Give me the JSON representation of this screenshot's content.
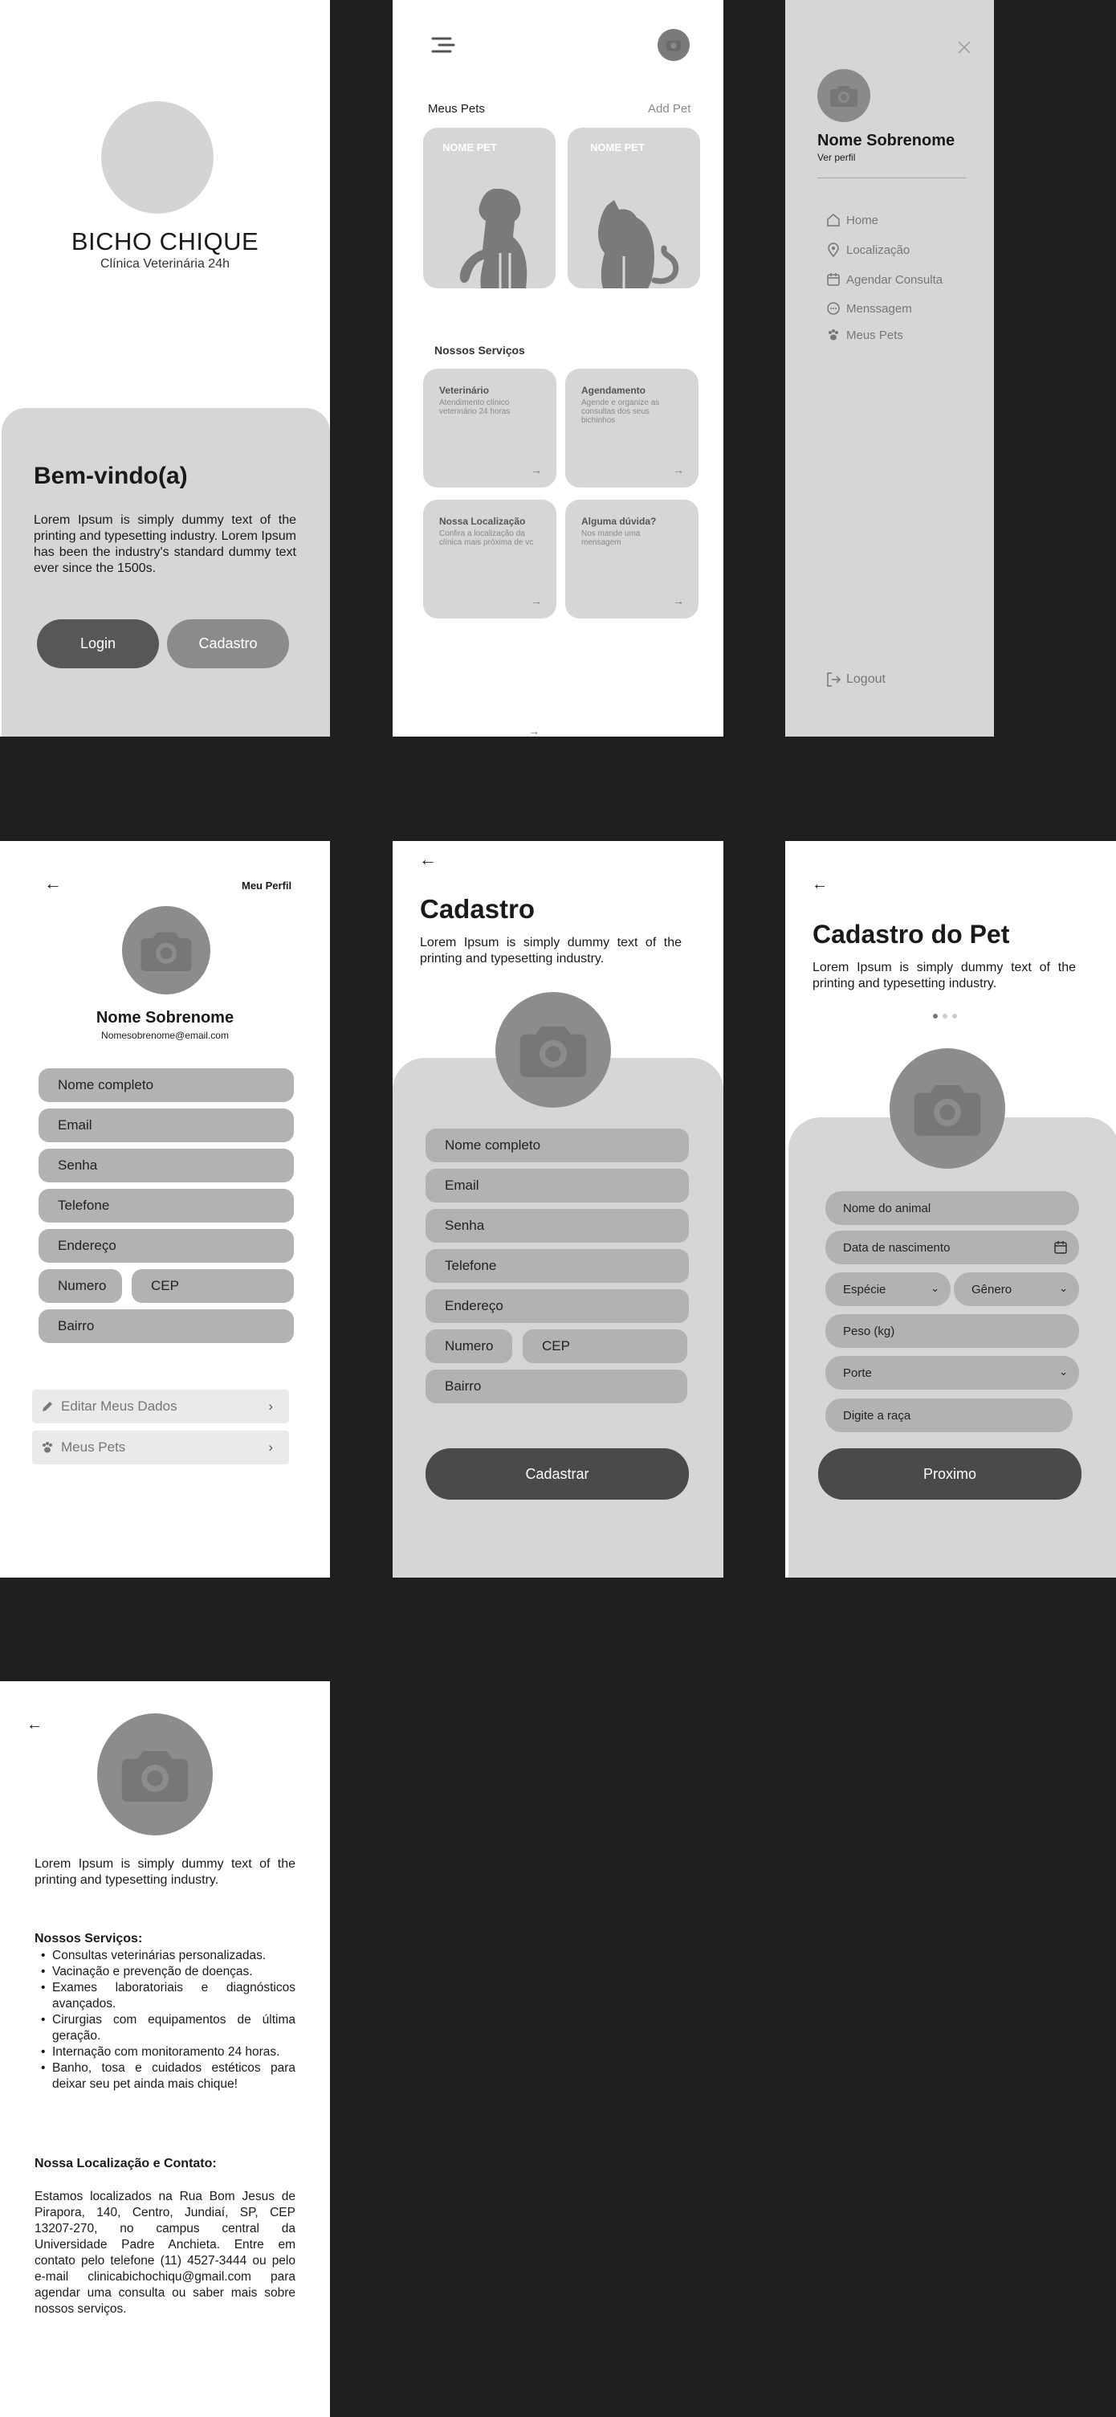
{
  "welcome": {
    "brand": "BICHO CHIQUE",
    "subtitle": "Clínica Veterinária 24h",
    "heading": "Bem-vindo(a)",
    "body": "Lorem Ipsum is simply dummy text of the printing and typesetting industry. Lorem Ipsum has been the industry's standard dummy text ever since the 1500s.",
    "login_label": "Login",
    "signup_label": "Cadastro"
  },
  "home": {
    "my_pets_label": "Meus Pets",
    "add_pet_label": "Add Pet",
    "pet_cards": [
      "NOME PET",
      "NOME PET"
    ],
    "services_label": "Nossos Serviços",
    "services": [
      {
        "title": "Veterinário",
        "desc": "Atendimento clínico veterinário 24 horas"
      },
      {
        "title": "Agendamento",
        "desc": "Agende e organize as consultas dos seus bichinhos"
      },
      {
        "title": "Nossa Localização",
        "desc": "Confira a localização da clínica mais próxima de vc"
      },
      {
        "title": "Alguma dúvida?",
        "desc": "Nos mande uma mensagem"
      }
    ]
  },
  "drawer": {
    "name": "Nome Sobrenome",
    "profile_link": "Ver perfil",
    "items": [
      "Home",
      "Localização",
      "Agendar Consulta",
      "Menssagem",
      "Meus Pets"
    ],
    "logout_label": "Logout"
  },
  "profile": {
    "title": "Meu Perfil",
    "name": "Nome Sobrenome",
    "email": "Nomesobrenome@email.com",
    "fields": {
      "full_name": "Nome completo",
      "email": "Email",
      "password": "Senha",
      "phone": "Telefone",
      "address": "Endereço",
      "number": "Numero",
      "cep": "CEP",
      "district": "Bairro"
    },
    "edit_label": "Editar Meus Dados",
    "pets_label": "Meus Pets"
  },
  "signup": {
    "title": "Cadastro",
    "body": "Lorem Ipsum is simply dummy text of the printing and typesetting industry.",
    "fields": {
      "full_name": "Nome completo",
      "email": "Email",
      "password": "Senha",
      "phone": "Telefone",
      "address": "Endereço",
      "number": "Numero",
      "cep": "CEP",
      "district": "Bairro"
    },
    "submit_label": "Cadastrar"
  },
  "pet_signup": {
    "title": "Cadastro do Pet",
    "body": "Lorem Ipsum is simply dummy text of the printing and typesetting industry.",
    "fields": {
      "animal_name": "Nome do animal",
      "birth_date": "Data de nascimento",
      "species": "Espécie",
      "gender": "Gênero",
      "weight": "Peso (kg)",
      "size": "Porte",
      "breed": "Digite a raça"
    },
    "next_label": "Proximo"
  },
  "about": {
    "intro": "Lorem Ipsum is simply dummy text of the printing and typesetting industry.",
    "services_heading": "Nossos Serviços:",
    "services": [
      "Consultas veterinárias personalizadas.",
      "Vacinação e prevenção de doenças.",
      "Exames laboratoriais e diagnósticos avançados.",
      "Cirurgias com equipamentos de última geração.",
      "Internação com monitoramento 24 horas.",
      "Banho, tosa e cuidados estéticos para deixar seu pet ainda mais chique!"
    ],
    "location_heading": "Nossa Localização e Contato:",
    "location_text": "Estamos localizados na Rua Bom Jesus de Pirapora, 140, Centro, Jundiaí, SP, CEP 13207-270, no campus central da Universidade Padre Anchieta. Entre em contato pelo telefone (11) 4527-3444 ou pelo e-mail clinicabichochiqu@gmail.com para agendar uma consulta ou saber mais sobre nossos serviços."
  },
  "colors": {
    "background": "#1f1f1f",
    "panel": "#d6d6d6",
    "field": "#b2b2b2",
    "dark_button": "#4a4a4a",
    "avatar": "#8c8c8c"
  }
}
